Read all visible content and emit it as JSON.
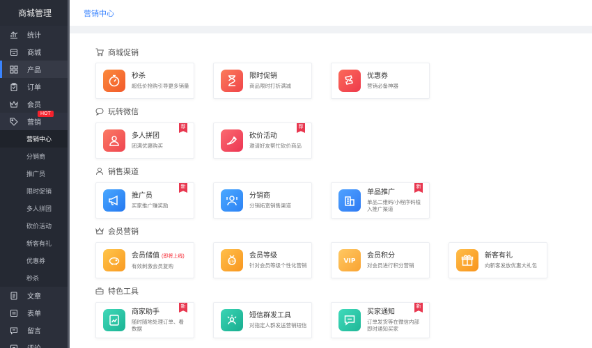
{
  "sidebar": {
    "brand": "商城管理",
    "items": [
      {
        "label": "统计",
        "icon": "bar-chart-icon"
      },
      {
        "label": "商城",
        "icon": "store-icon"
      },
      {
        "label": "产品",
        "icon": "grid-icon"
      },
      {
        "label": "订单",
        "icon": "clipboard-icon"
      },
      {
        "label": "会员",
        "icon": "crown-icon"
      },
      {
        "label": "营销",
        "icon": "tag-icon",
        "badge": "HOT"
      },
      {
        "label": "文章",
        "icon": "document-icon"
      },
      {
        "label": "表单",
        "icon": "form-icon"
      },
      {
        "label": "留言",
        "icon": "message-icon"
      },
      {
        "label": "评论",
        "icon": "comment-icon"
      }
    ],
    "sub_items": [
      {
        "label": "营销中心"
      },
      {
        "label": "分销商"
      },
      {
        "label": "推广员"
      },
      {
        "label": "限时促销"
      },
      {
        "label": "多人拼团"
      },
      {
        "label": "砍价活动"
      },
      {
        "label": "新客有礼"
      },
      {
        "label": "优惠券"
      },
      {
        "label": "秒杀"
      }
    ]
  },
  "header": {
    "breadcrumb": "营销中心"
  },
  "badges": {
    "recommend": "荐",
    "new": "新"
  },
  "sections": [
    {
      "title": "商城促销",
      "icon": "cart-icon",
      "cards": [
        {
          "title": "秒杀",
          "desc": "超低价抢购引导更多销量",
          "icon": "stopwatch-icon",
          "color": "#f7682f"
        },
        {
          "title": "限时促销",
          "desc": "商品限时打折满减",
          "icon": "hourglass-icon",
          "color": "#f5574b"
        },
        {
          "title": "优惠券",
          "desc": "营销必备神器",
          "icon": "coupon-icon",
          "color": "#f4464c"
        }
      ]
    },
    {
      "title": "玩转微信",
      "icon": "chat-bubble-icon",
      "cards": [
        {
          "title": "多人拼团",
          "desc": "团满优惠购买",
          "icon": "group-icon",
          "color": "#f35a52"
        },
        {
          "title": "砍价活动",
          "desc": "邀请好友帮忙砍价商品",
          "icon": "bargain-icon",
          "color": "#f24b5a"
        }
      ]
    },
    {
      "title": "销售渠道",
      "icon": "user-icon",
      "cards": [
        {
          "title": "推广员",
          "desc": "买家推广赚奖励",
          "icon": "megaphone-icon",
          "color": "#2f8cf6"
        },
        {
          "title": "分销商",
          "desc": "分销拓宽销售渠道",
          "icon": "distributor-icon",
          "color": "#2a93f5"
        },
        {
          "title": "单品推广",
          "desc": "单品二维码/小程序码植入推广渠道",
          "icon": "building-icon",
          "color": "#3a86f7"
        }
      ]
    },
    {
      "title": "会员营销",
      "icon": "crown-icon",
      "cards": [
        {
          "title": "会员储值",
          "tag": "(即将上线)",
          "desc": "有效刺激会员复购",
          "icon": "piggy-bank-icon",
          "color": "#fbaa2c"
        },
        {
          "title": "会员等级",
          "desc": "针对会员等级个性化营销",
          "icon": "medal-icon",
          "color": "#fca330"
        },
        {
          "title": "会员积分",
          "desc": "对会员进行积分营销",
          "icon": "vip-icon",
          "color": "#fcb446"
        },
        {
          "title": "新客有礼",
          "desc": "向新客发放优惠大礼包",
          "icon": "gift-icon",
          "color": "#fca02b"
        }
      ]
    },
    {
      "title": "特色工具",
      "icon": "toolbox-icon",
      "cards": [
        {
          "title": "商家助手",
          "desc": "随时随地处理订单、看数据",
          "icon": "assistant-icon",
          "color": "#25c3a6"
        },
        {
          "title": "短信群发工具",
          "desc": "对指定人群发送营销短信",
          "icon": "sms-icon",
          "color": "#22bea0"
        },
        {
          "title": "买家通知",
          "desc": "订单发货等在微信内部即时通知买家",
          "icon": "notify-icon",
          "color": "#26c6a9"
        }
      ]
    }
  ]
}
